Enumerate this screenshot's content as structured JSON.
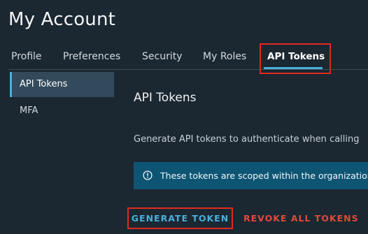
{
  "page": {
    "title": "My Account"
  },
  "tabs": [
    {
      "label": "Profile",
      "active": false
    },
    {
      "label": "Preferences",
      "active": false
    },
    {
      "label": "Security",
      "active": false
    },
    {
      "label": "My Roles",
      "active": false
    },
    {
      "label": "API Tokens",
      "active": true
    }
  ],
  "sidebar": {
    "items": [
      {
        "label": "API Tokens",
        "active": true
      },
      {
        "label": "MFA",
        "active": false
      }
    ]
  },
  "content": {
    "title": "API Tokens",
    "description": "Generate API tokens to authenticate when calling",
    "alert": {
      "icon": "info-circle-icon",
      "text": "These tokens are scoped within the organization"
    }
  },
  "actions": {
    "generate_label": "GENERATE TOKEN",
    "revoke_label": "REVOKE ALL TOKENS"
  },
  "colors": {
    "background": "#1b2731",
    "accent": "#49afd9",
    "danger": "#e0493a",
    "highlight_outline": "#e02a1f",
    "alert_background": "#0e5574"
  }
}
